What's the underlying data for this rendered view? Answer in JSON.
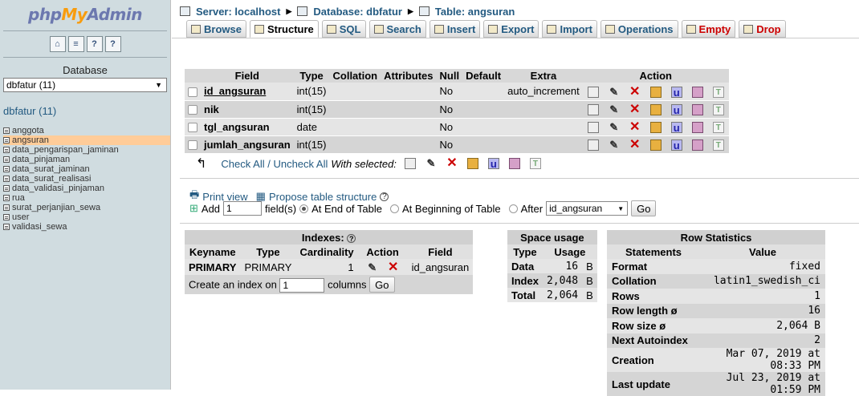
{
  "sidebar": {
    "logo_a": "php",
    "logo_b": "My",
    "logo_c": "Admin",
    "database_label": "Database",
    "db_select": "dbfatur (11)",
    "db_name": "dbfatur",
    "db_count": "(11)",
    "tables": [
      "anggota",
      "angsuran",
      "data_pengarispan_jaminan",
      "data_pinjaman",
      "data_surat_jaminan",
      "data_surat_realisasi",
      "data_validasi_pinjaman",
      "rua",
      "surat_perjanjian_sewa",
      "user",
      "validasi_sewa"
    ]
  },
  "breadcrumb": {
    "server": "Server: localhost",
    "database": "Database: dbfatur",
    "table": "Table: angsuran"
  },
  "tabs": [
    "Browse",
    "Structure",
    "SQL",
    "Search",
    "Insert",
    "Export",
    "Import",
    "Operations",
    "Empty",
    "Drop"
  ],
  "fields": {
    "headers": [
      "Field",
      "Type",
      "Collation",
      "Attributes",
      "Null",
      "Default",
      "Extra",
      "Action"
    ],
    "rows": [
      {
        "field": "id_angsuran",
        "type": "int(15)",
        "collation": "",
        "attributes": "",
        "null": "No",
        "default": "",
        "extra": "auto_increment"
      },
      {
        "field": "nik",
        "type": "int(15)",
        "collation": "",
        "attributes": "",
        "null": "No",
        "default": "",
        "extra": ""
      },
      {
        "field": "tgl_angsuran",
        "type": "date",
        "collation": "",
        "attributes": "",
        "null": "No",
        "default": "",
        "extra": ""
      },
      {
        "field": "jumlah_angsuran",
        "type": "int(15)",
        "collation": "",
        "attributes": "",
        "null": "No",
        "default": "",
        "extra": ""
      }
    ],
    "check_all": "Check All",
    "slash": " / ",
    "uncheck_all": "Uncheck All",
    "with_selected": "With selected:"
  },
  "tools": {
    "print_view": "Print view",
    "propose": "Propose table structure",
    "add": "Add",
    "add_value": "1",
    "fields_label": "field(s)",
    "at_end": "At End of Table",
    "at_beginning": "At Beginning of Table",
    "after": "After",
    "after_value": "id_angsuran",
    "go": "Go"
  },
  "indexes": {
    "caption": "Indexes:",
    "headers": [
      "Keyname",
      "Type",
      "Cardinality",
      "Action",
      "Field"
    ],
    "rows": [
      {
        "keyname": "PRIMARY",
        "type": "PRIMARY",
        "cardinality": "1",
        "field": "id_angsuran"
      }
    ],
    "create_prefix": "Create an index on",
    "create_value": "1",
    "create_suffix": "columns",
    "go": "Go"
  },
  "space": {
    "caption": "Space usage",
    "headers": [
      "Type",
      "Usage"
    ],
    "rows": [
      {
        "type": "Data",
        "usage": "16",
        "unit": "B"
      },
      {
        "type": "Index",
        "usage": "2,048",
        "unit": "B"
      },
      {
        "type": "Total",
        "usage": "2,064",
        "unit": "B"
      }
    ]
  },
  "rowstats": {
    "caption": "Row Statistics",
    "headers": [
      "Statements",
      "Value"
    ],
    "rows": [
      {
        "k": "Format",
        "v": "fixed"
      },
      {
        "k": "Collation",
        "v": "latin1_swedish_ci"
      },
      {
        "k": "Rows",
        "v": "1"
      },
      {
        "k": "Row length ø",
        "v": "16"
      },
      {
        "k": "Row size ø",
        "v": "2,064 B"
      },
      {
        "k": "Next Autoindex",
        "v": "2"
      },
      {
        "k": "Creation",
        "v": "Mar 07, 2019 at 08:33 PM"
      },
      {
        "k": "Last update",
        "v": "Jul 23, 2019 at 01:59 PM"
      }
    ]
  }
}
